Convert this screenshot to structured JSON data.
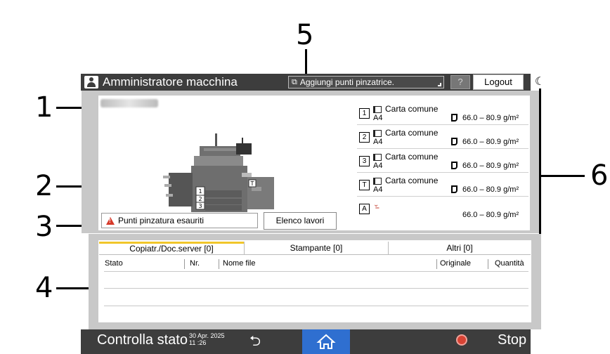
{
  "callouts": [
    "1",
    "2",
    "3",
    "4",
    "5",
    "6"
  ],
  "header": {
    "user_label": "Amministratore macchina",
    "notification": "Aggiungi punti pinzatrice.",
    "help_label": "?",
    "logout_label": "Logout"
  },
  "trays": [
    {
      "num": "1",
      "paper": "Carta comune",
      "size": "A4",
      "weight": "66.0 – 80.9 g/m²"
    },
    {
      "num": "2",
      "paper": "Carta comune",
      "size": "A4",
      "weight": "66.0 – 80.9 g/m²"
    },
    {
      "num": "3",
      "paper": "Carta comune",
      "size": "A4",
      "weight": "66.0 – 80.9 g/m²"
    },
    {
      "num": "T",
      "paper": "Carta comune",
      "size": "A4",
      "weight": "66.0 – 80.9 g/m²"
    },
    {
      "num": "A",
      "paper": "",
      "size": "",
      "weight": "66.0 – 80.9 g/m²"
    }
  ],
  "alert": {
    "text": "Punti pinzatura esauriti"
  },
  "job_list_button": "Elenco lavori",
  "tabs": [
    {
      "label": "Copiatr./Doc.server [0]",
      "active": true
    },
    {
      "label": "Stampante [0]",
      "active": false
    },
    {
      "label": "Altri [0]",
      "active": false
    }
  ],
  "columns": [
    "Stato",
    "Nr.",
    "Nome file",
    "Originale",
    "Quantità"
  ],
  "footer": {
    "status_label": "Controlla stato",
    "date": "30 Apr. 2025",
    "time": "11 :26",
    "stop_label": "Stop"
  },
  "colors": {
    "home_button": "#2f6fd0",
    "active_tab": "#f0c62a",
    "stop": "#d84334",
    "bar": "#3d3d3d"
  }
}
